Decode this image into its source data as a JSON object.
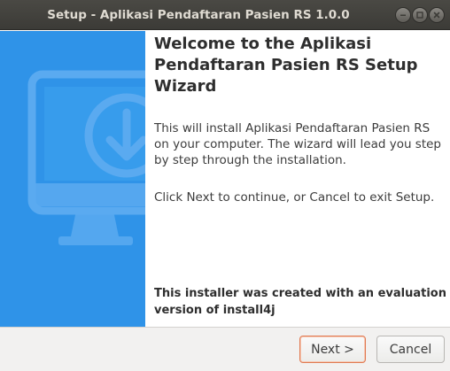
{
  "window": {
    "title": "Setup - Aplikasi Pendaftaran Pasien RS 1.0.0",
    "controls": {
      "minimize_icon": "minimize-icon",
      "maximize_icon": "maximize-icon",
      "close_icon": "close-icon"
    }
  },
  "banner": {
    "icon": "monitor-download-icon",
    "color": "#2f93e8"
  },
  "content": {
    "heading": "Welcome to the Aplikasi Pendaftaran Pasien RS Setup Wizard",
    "paragraph1": "This will install Aplikasi Pendaftaran Pasien RS on your computer. The wizard will lead you step by step through the installation.",
    "paragraph2": "Click Next to continue, or Cancel to exit Setup.",
    "note": "This installer was created with an evaluation version of install4j"
  },
  "footer": {
    "next_label": "Next >",
    "cancel_label": "Cancel",
    "accent": "#e07a52"
  }
}
